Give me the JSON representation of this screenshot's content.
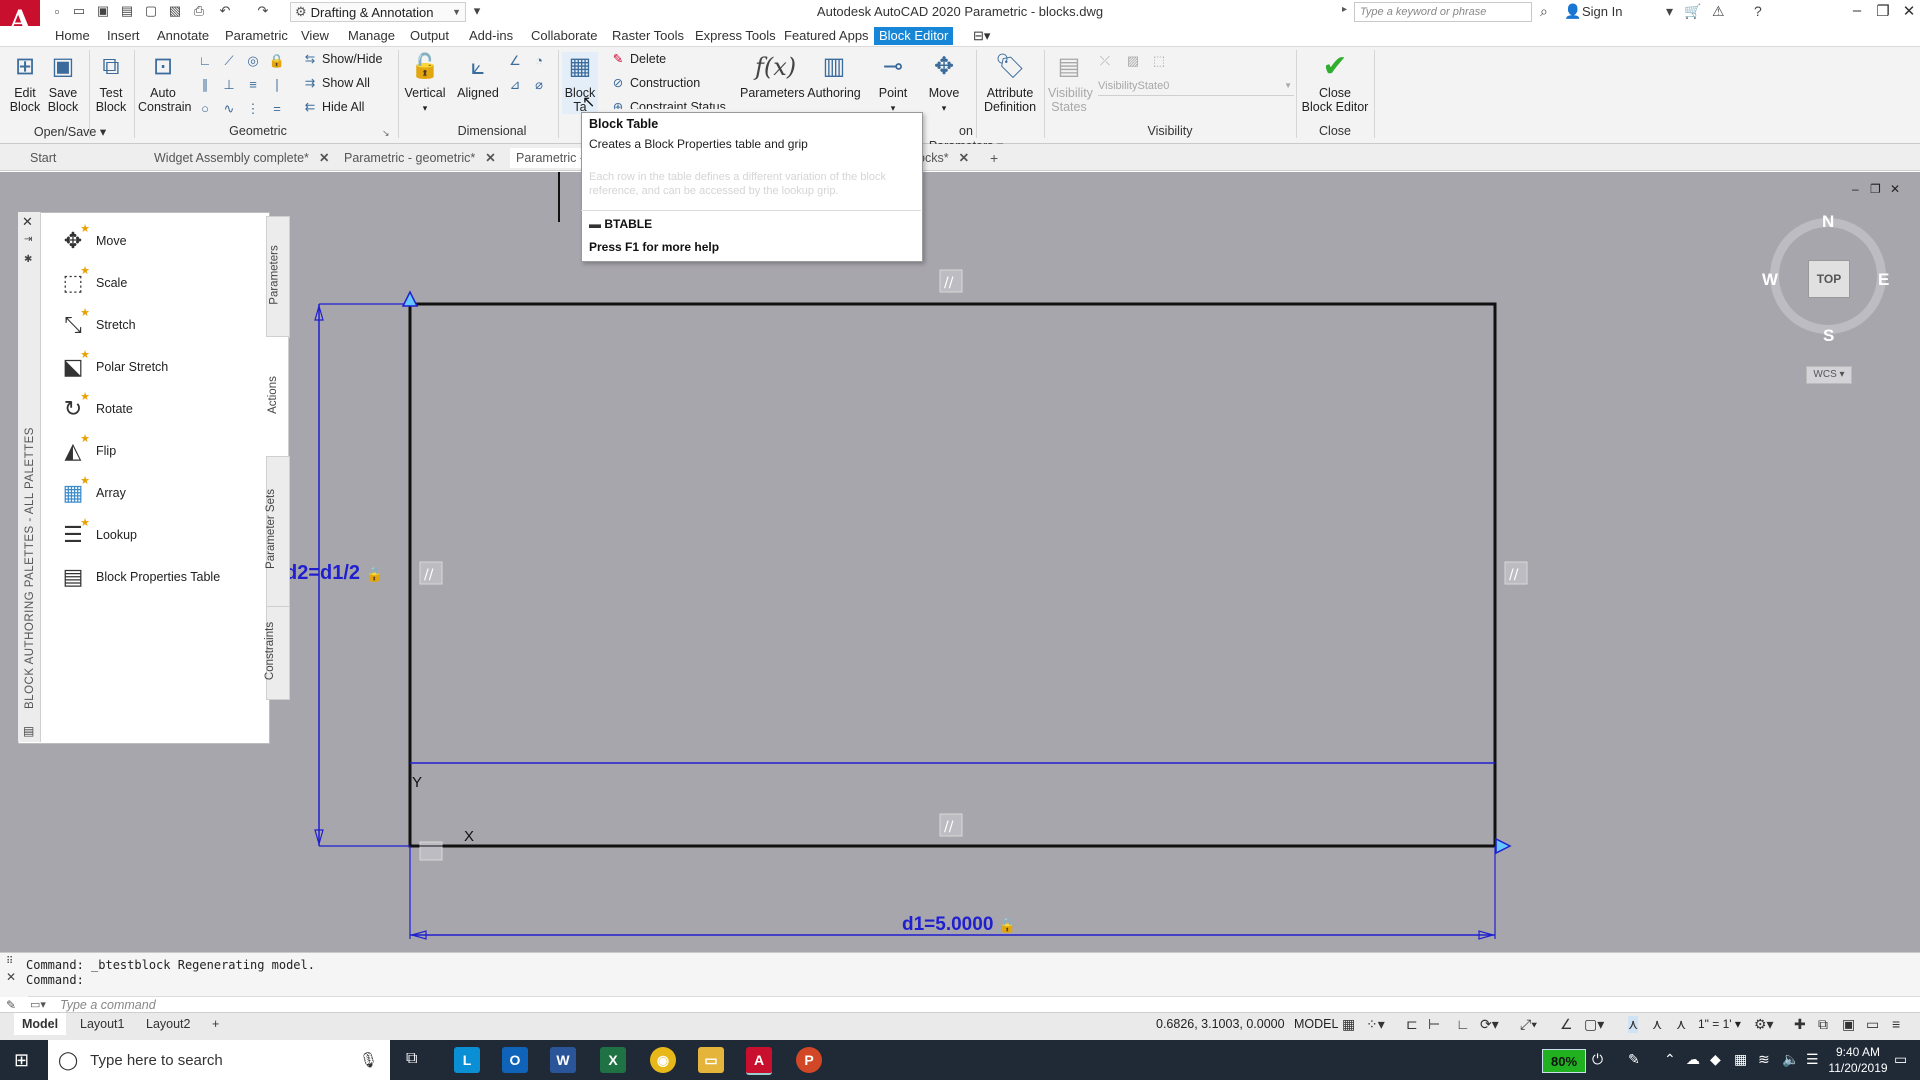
{
  "titlebar": {
    "workspace": "Drafting & Annotation",
    "title": "Autodesk AutoCAD 2020    Parametric - blocks.dwg",
    "search_placeholder": "Type a keyword or phrase",
    "signin": "Sign In"
  },
  "menu_tabs": [
    "Home",
    "Insert",
    "Annotate",
    "Parametric",
    "View",
    "Manage",
    "Output",
    "Add-ins",
    "Collaborate",
    "Raster Tools",
    "Express Tools",
    "Featured Apps",
    "Block Editor"
  ],
  "ribbon": {
    "edit_block": [
      "Edit",
      "Block"
    ],
    "save_block": [
      "Save",
      "Block"
    ],
    "test_block": [
      "Test",
      "Block"
    ],
    "auto_constrain": [
      "Auto",
      "Constrain"
    ],
    "show_hide": "Show/Hide",
    "show_all": "Show All",
    "hide_all": "Hide All",
    "vertical": "Vertical",
    "aligned": "Aligned",
    "block_table": [
      "Block",
      "Ta"
    ],
    "delete": "Delete",
    "construction": "Construction",
    "constraint_status": "Constraint Status",
    "parameters": "Parameters",
    "authoring": "Authoring",
    "point": "Point",
    "move": "Move",
    "attribute_definition": [
      "Attribute",
      "Definition"
    ],
    "visibility_states": [
      "Visibility",
      "States"
    ],
    "visibility_state_value": "VisibilityState0",
    "close_block_editor": [
      "Close",
      "Block Editor"
    ],
    "groups": {
      "open_save": "Open/Save",
      "geometric": "Geometric",
      "dimensional": "Dimensional",
      "action_parameters": "on Parameters",
      "visibility": "Visibility",
      "close": "Close"
    }
  },
  "file_tabs": [
    {
      "label": "Start"
    },
    {
      "label": "Widget Assembly complete*"
    },
    {
      "label": "Parametric - geometric*"
    },
    {
      "label": "Parametric -"
    },
    {
      "label": "ocks*"
    }
  ],
  "tooltip": {
    "title": "Block Table",
    "description": "Creates a Block Properties table and grip",
    "faded_text": "Each row in the table defines a different variation of the block reference, and can be accessed by the lookup grip.",
    "command": "BTABLE",
    "help": "Press F1 for more help"
  },
  "palette": {
    "title": "BLOCK AUTHORING PALETTES - ALL PALETTES",
    "items": [
      "Move",
      "Scale",
      "Stretch",
      "Polar Stretch",
      "Rotate",
      "Flip",
      "Array",
      "Lookup",
      "Block Properties Table"
    ],
    "tabs": [
      "Parameters",
      "Actions",
      "Parameter Sets",
      "Constraints"
    ]
  },
  "drawing": {
    "dim_d1": "d1=5.0000",
    "dim_d2": "d2=d1/2",
    "axis_y": "Y",
    "axis_x": "X"
  },
  "viewcube": {
    "n": "N",
    "s": "S",
    "e": "E",
    "w": "W",
    "top": "TOP",
    "wcs": "WCS"
  },
  "command": {
    "history": [
      "Command:  _btestblock Regenerating model.",
      "Command:"
    ],
    "placeholder": "Type a command"
  },
  "status": {
    "layout_tabs": [
      "Model",
      "Layout1",
      "Layout2"
    ],
    "coords": "0.6826, 3.1003, 0.0000",
    "model": "MODEL",
    "scale": "1\" = 1'"
  },
  "taskbar": {
    "search": "Type here to search",
    "battery": "80%",
    "time": "9:40 AM",
    "date": "11/20/2019"
  },
  "colors": {
    "accent": "#1786d6",
    "dimension": "#1f1fd0",
    "canvas": "#a8a6ad",
    "geometry": "#111111"
  }
}
